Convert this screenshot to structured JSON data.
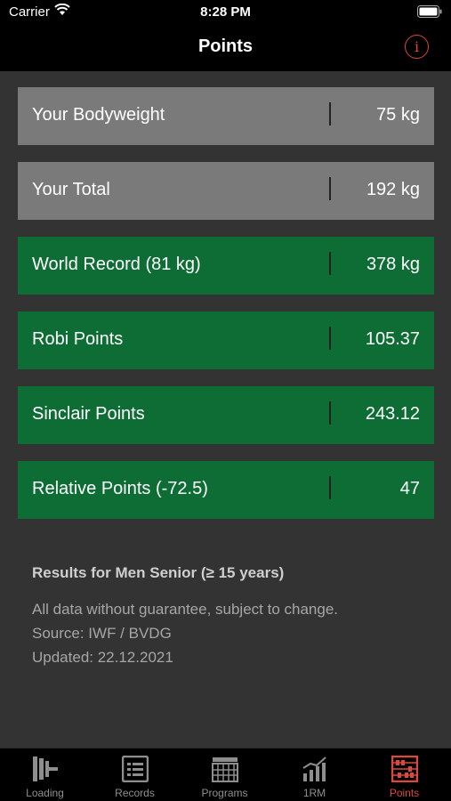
{
  "status_bar": {
    "carrier": "Carrier",
    "time": "8:28 PM"
  },
  "nav": {
    "title": "Points",
    "info_icon": "info-icon"
  },
  "rows": [
    {
      "label": "Your Bodyweight",
      "value": "75 kg",
      "style": "gray"
    },
    {
      "label": "Your Total",
      "value": "192 kg",
      "style": "gray"
    },
    {
      "label": "World Record (81 kg)",
      "value": "378 kg",
      "style": "green"
    },
    {
      "label": "Robi Points",
      "value": "105.37",
      "style": "green"
    },
    {
      "label": "Sinclair Points",
      "value": "243.12",
      "style": "green"
    },
    {
      "label": "Relative Points (-72.5)",
      "value": "47",
      "style": "green"
    }
  ],
  "notes": {
    "heading": "Results for Men Senior (≥ 15 years)",
    "lines": [
      "All data without guarantee, subject to change.",
      "Source: IWF / BVDG",
      "Updated: 22.12.2021"
    ]
  },
  "tabs": [
    {
      "label": "Loading",
      "icon": "barbell-icon",
      "active": false
    },
    {
      "label": "Records",
      "icon": "list-icon",
      "active": false
    },
    {
      "label": "Programs",
      "icon": "calendar-icon",
      "active": false
    },
    {
      "label": "1RM",
      "icon": "chart-icon",
      "active": false
    },
    {
      "label": "Points",
      "icon": "abacus-icon",
      "active": true
    }
  ],
  "colors": {
    "accent": "#d94a3c",
    "green_row": "#0e6d35",
    "gray_row": "#7a7a7a",
    "background": "#333333"
  }
}
